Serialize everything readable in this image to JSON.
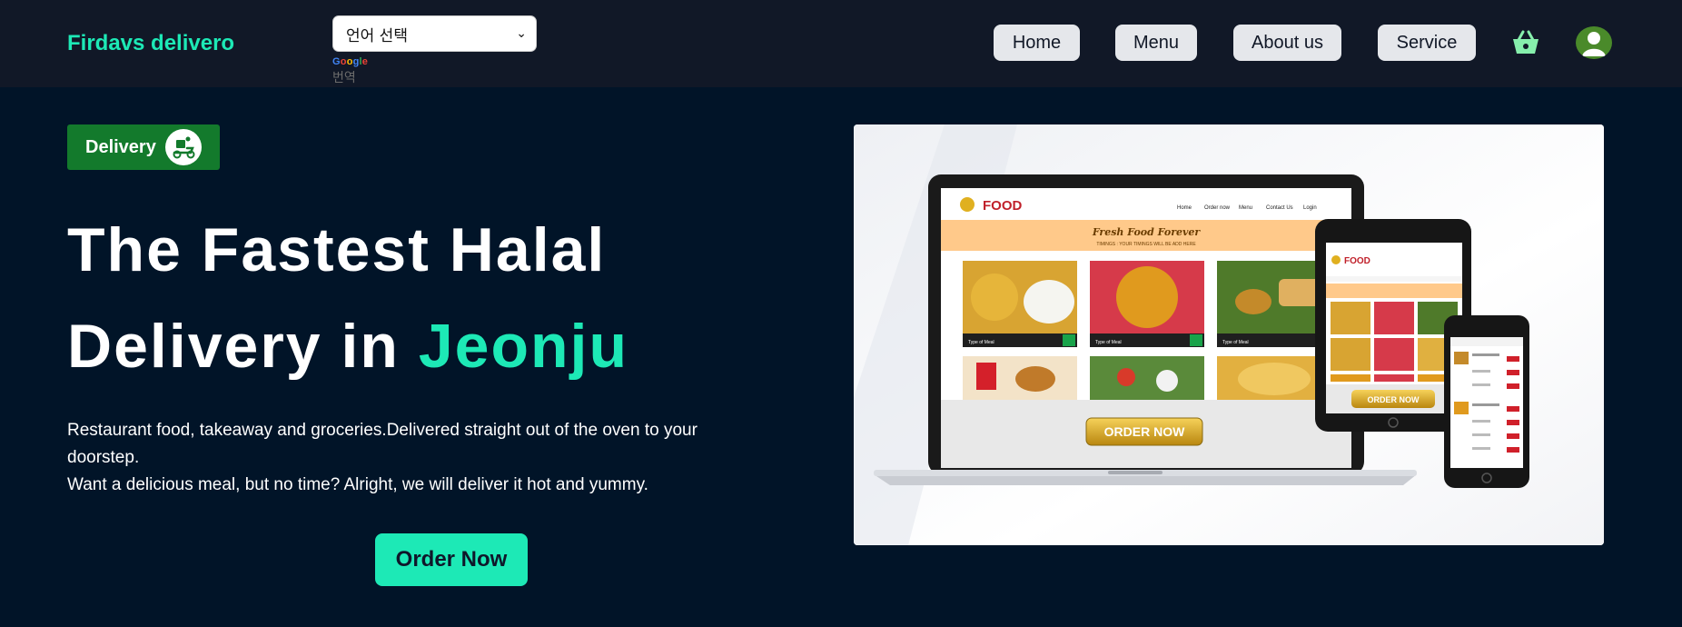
{
  "brand": "Firdavs delivero",
  "language": {
    "selected": "언어 선택",
    "google": [
      "G",
      "o",
      "o",
      "g",
      "l",
      "e"
    ],
    "google_colors": [
      "#4285F4",
      "#EA4335",
      "#FBBC05",
      "#4285F4",
      "#34A853",
      "#EA4335"
    ],
    "translate": "번역"
  },
  "nav": {
    "home": "Home",
    "menu": "Menu",
    "about": "About us",
    "service": "Service",
    "cart_icon": "basket-icon",
    "avatar_icon": "user-avatar-icon"
  },
  "badge": {
    "label": "Delivery",
    "icon": "delivery-scooter-icon"
  },
  "hero": {
    "line1": "The Fastest Halal",
    "line2_prefix": "Delivery in ",
    "line2_accent": "Jeonju",
    "desc1": "Restaurant food, takeaway and groceries.Delivered straight out of the oven to your doorstep.",
    "desc2": "Want a delicious meal, but no time? Alright, we will deliver it hot and yummy.",
    "cta": "Order Now"
  },
  "mockup": {
    "logo": "FOOD",
    "banner_title": "Fresh Food Forever",
    "banner_sub": "TIMINGS : YOUR TIMINGS WILL BE ADD HERE",
    "nav_items": [
      "Home",
      "Order now",
      "Menu",
      "Contact Us",
      "Login"
    ],
    "card_label": "Type of Meal",
    "cta": "ORDER NOW"
  },
  "colors": {
    "accent": "#1de9b6",
    "background": "#011428",
    "navbar": "#111827",
    "badge": "#137a2c"
  }
}
